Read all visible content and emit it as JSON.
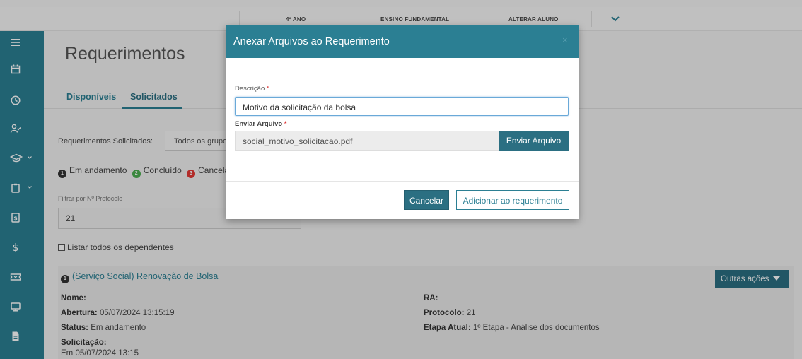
{
  "topbar": {
    "items": [
      "4º ANO",
      "ENSINO FUNDAMENTAL",
      "ALTERAR ALUNO"
    ]
  },
  "sidebar": {
    "items": [
      {
        "icon": "menu-icon"
      },
      {
        "icon": "calendar-icon"
      },
      {
        "icon": "clock-icon"
      },
      {
        "icon": "user-check-icon"
      },
      {
        "icon": "graduation-cap-icon",
        "has_caret": true
      },
      {
        "icon": "clipboard-icon",
        "has_caret": true
      },
      {
        "icon": "document-dollar-icon"
      },
      {
        "icon": "dollar-icon"
      },
      {
        "icon": "ticket-icon"
      },
      {
        "icon": "monitor-icon"
      },
      {
        "icon": "file-icon"
      }
    ]
  },
  "page": {
    "title": "Requerimentos",
    "tabs": [
      "Disponíveis",
      "Solicitados"
    ],
    "filter_label": "Requerimentos Solicitados:",
    "filter_value": "Todos os grupos",
    "legend": [
      {
        "num": "1",
        "label": "Em andamento",
        "color": "#333333"
      },
      {
        "num": "2",
        "label": "Concluído",
        "color": "#4caf50"
      },
      {
        "num": "3",
        "label": "Cancelado",
        "color": "#e53935"
      }
    ],
    "protocol_label": "Filtrar por Nº Protocolo",
    "protocol_value": "21",
    "list_dependents": "Listar todos os dependentes"
  },
  "card": {
    "num": "1",
    "title": "(Serviço Social) Renovação de Bolsa",
    "actions_label": "Outras ações",
    "nome_label": "Nome:",
    "nome_value": "",
    "abertura_label": "Abertura:",
    "abertura_value": "05/07/2024 13:15:19",
    "status_label": "Status:",
    "status_value": "Em andamento",
    "solicitacao_label": "Solicitação:",
    "solicitacao_value": "Em 05/07/2024 13:15",
    "ra_label": "RA:",
    "ra_value": "",
    "protocolo_label": "Protocolo:",
    "protocolo_value": "21",
    "etapa_label": "Etapa Atual:",
    "etapa_value": "1º Etapa - Análise dos documentos"
  },
  "modal": {
    "title": "Anexar Arquivos ao Requerimento",
    "close": "×",
    "desc_label": "Descrição",
    "required_mark": "*",
    "desc_value": "Motivo da solicitação da bolsa",
    "file_label": "Enviar Arquivo",
    "file_value": "social_motivo_solicitacao.pdf",
    "send_button": "Enviar Arquivo",
    "cancel_button": "Cancelar",
    "add_button": "Adicionar ao requerimento"
  },
  "colors": {
    "primary": "#2b7f93",
    "primary_dark": "#2b6f82"
  }
}
